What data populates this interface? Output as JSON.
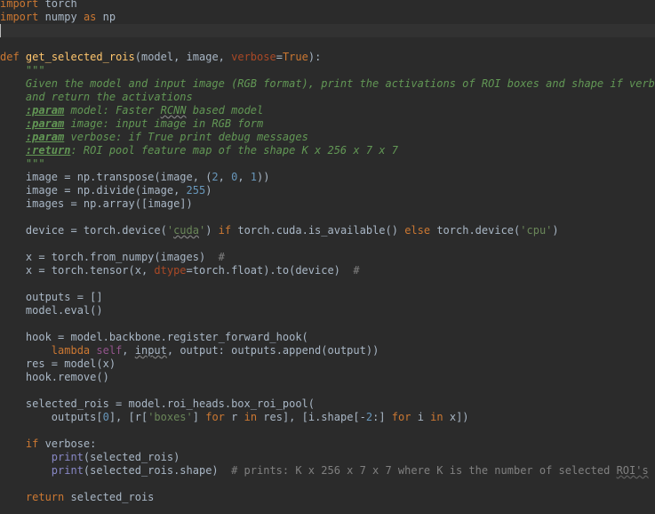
{
  "editor": {
    "language": "python",
    "theme": "dark",
    "caret_line": 3
  },
  "code_lines": [
    "import torch",
    "import numpy as np",
    "",
    "",
    "def get_selected_rois(model, image, verbose=True):",
    "    \"\"\"",
    "    Given the model and input image (RGB format), print the activations of ROI boxes and shape if verbose",
    "    and return the activations",
    "    :param model: Faster RCNN based model",
    "    :param image: input image in RGB form",
    "    :param verbose: if True print debug messages",
    "    :return: ROI pool feature map of the shape K x 256 x 7 x 7",
    "    \"\"\"",
    "    image = np.transpose(image, (2, 0, 1))",
    "    image = np.divide(image, 255)",
    "    images = np.array([image])",
    "",
    "    device = torch.device('cuda') if torch.cuda.is_available() else torch.device('cpu')",
    "",
    "    x = torch.from_numpy(images)  #",
    "    x = torch.tensor(x, dtype=torch.float).to(device)  #",
    "",
    "    outputs = []",
    "    model.eval()",
    "",
    "    hook = model.backbone.register_forward_hook(",
    "        lambda self, input, output: outputs.append(output))",
    "    res = model(x)",
    "    hook.remove()",
    "",
    "    selected_rois = model.roi_heads.box_roi_pool(",
    "        outputs[0], [r['boxes'] for r in res], [i.shape[-2:] for i in x])",
    "",
    "    if verbose:",
    "        print(selected_rois)",
    "        print(selected_rois.shape)  # prints: K x 256 x 7 x 7 where K is the number of selected ROI's",
    "",
    "    return selected_rois"
  ]
}
